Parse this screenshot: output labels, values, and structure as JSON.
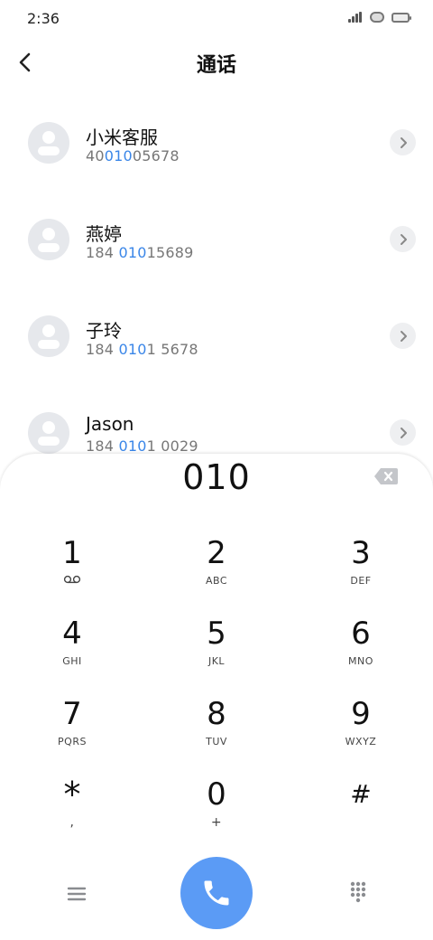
{
  "status_bar": {
    "time": "2:36"
  },
  "header": {
    "title": "通话"
  },
  "contacts": [
    {
      "name": "小米客服",
      "number_prefix": "40",
      "number_match": "010",
      "number_suffix": "05678"
    },
    {
      "name": "燕婷",
      "number_prefix": "184 ",
      "number_match": "010",
      "number_suffix": "15689"
    },
    {
      "name": "子玲",
      "number_prefix": "184 ",
      "number_match": "010",
      "number_suffix": "1 5678"
    },
    {
      "name": "Jason",
      "number_prefix": "184 ",
      "number_match": "010",
      "number_suffix": "1 0029"
    }
  ],
  "dialpad": {
    "input_value": "010",
    "keys": [
      {
        "digit": "1",
        "letters": ""
      },
      {
        "digit": "2",
        "letters": "ABC"
      },
      {
        "digit": "3",
        "letters": "DEF"
      },
      {
        "digit": "4",
        "letters": "GHI"
      },
      {
        "digit": "5",
        "letters": "JKL"
      },
      {
        "digit": "6",
        "letters": "MNO"
      },
      {
        "digit": "7",
        "letters": "PQRS"
      },
      {
        "digit": "8",
        "letters": "TUV"
      },
      {
        "digit": "9",
        "letters": "WXYZ"
      },
      {
        "digit": "*",
        "letters": ","
      },
      {
        "digit": "0",
        "letters": "+"
      },
      {
        "digit": "#",
        "letters": ""
      }
    ]
  },
  "colors": {
    "accent": "#3a86e8",
    "call_button": "#5b9bf5"
  },
  "icons": [
    "back-icon",
    "chevron-right-icon",
    "backspace-icon",
    "voicemail-icon",
    "menu-icon",
    "phone-icon",
    "dialpad-icon"
  ]
}
